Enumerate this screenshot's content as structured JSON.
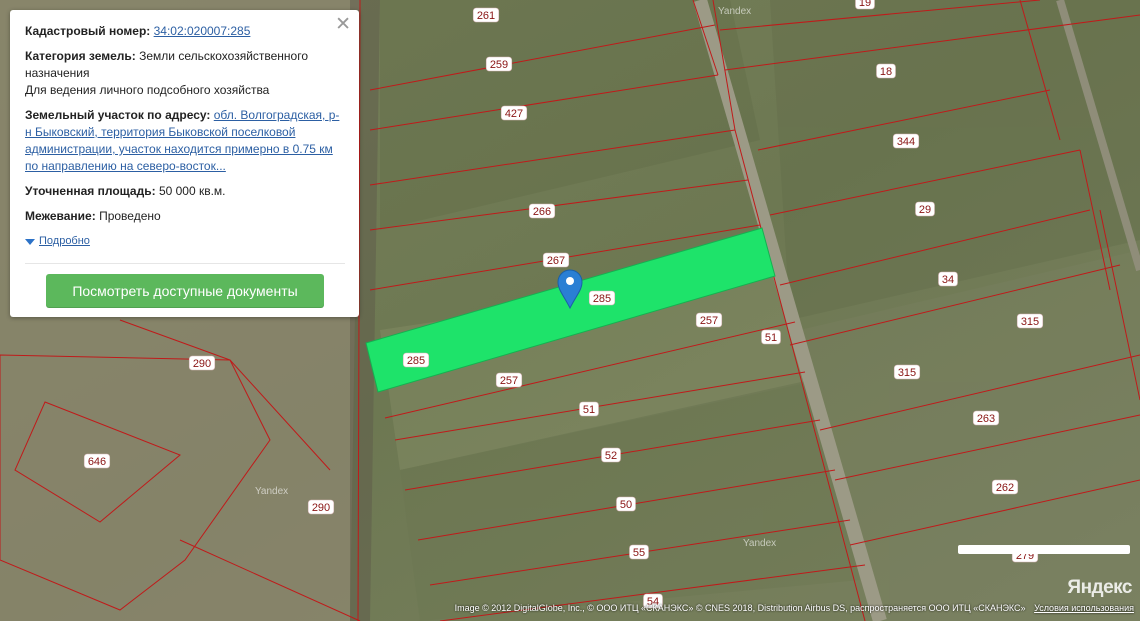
{
  "card": {
    "cadastral_label": "Кадастровый номер:",
    "cadastral_value": "34:02:020007:285",
    "category_label": "Категория земель:",
    "category_value": "Земли сельскохозяйственного назначения",
    "use_value": "Для ведения личного подсобного хозяйства",
    "address_label": "Земельный участок по адресу:",
    "address_value": "обл. Волгоградская, р-н Быковский, территория Быковской поселковой администрации, участок находится примерно в 0.75 км по направлению на северо-восток...",
    "area_label": "Уточненная площадь:",
    "area_value": "50 000 кв.м.",
    "survey_label": "Межевание:",
    "survey_value": "Проведено",
    "more_label": "Подробно",
    "docs_button": "Посмотреть доступные документы",
    "close_icon": "close-icon"
  },
  "map": {
    "selected_color": "#1ee36a",
    "boundary_color": "#c01a1a",
    "marker_color": "#2a7fd4",
    "plot_labels": [
      "261",
      "19",
      "259",
      "18",
      "427",
      "344",
      "266",
      "29",
      "267",
      "285",
      "285",
      "34",
      "257",
      "51",
      "315",
      "290",
      "257",
      "315",
      "51",
      "263",
      "646",
      "52",
      "262",
      "290",
      "50",
      "55",
      "279",
      "54"
    ],
    "watermarks": [
      "Yandex",
      "Yandex",
      "Yandex"
    ]
  },
  "attribution": {
    "text": "Image © 2012 DigitalGlobe, Inc., © ООО ИТЦ «СКАНЭКС» © CNES 2018, Distribution Airbus DS, распространяется ООО ИТЦ «СКАНЭКС»",
    "terms_link": "Условия использования",
    "logo": "Яндекс"
  }
}
